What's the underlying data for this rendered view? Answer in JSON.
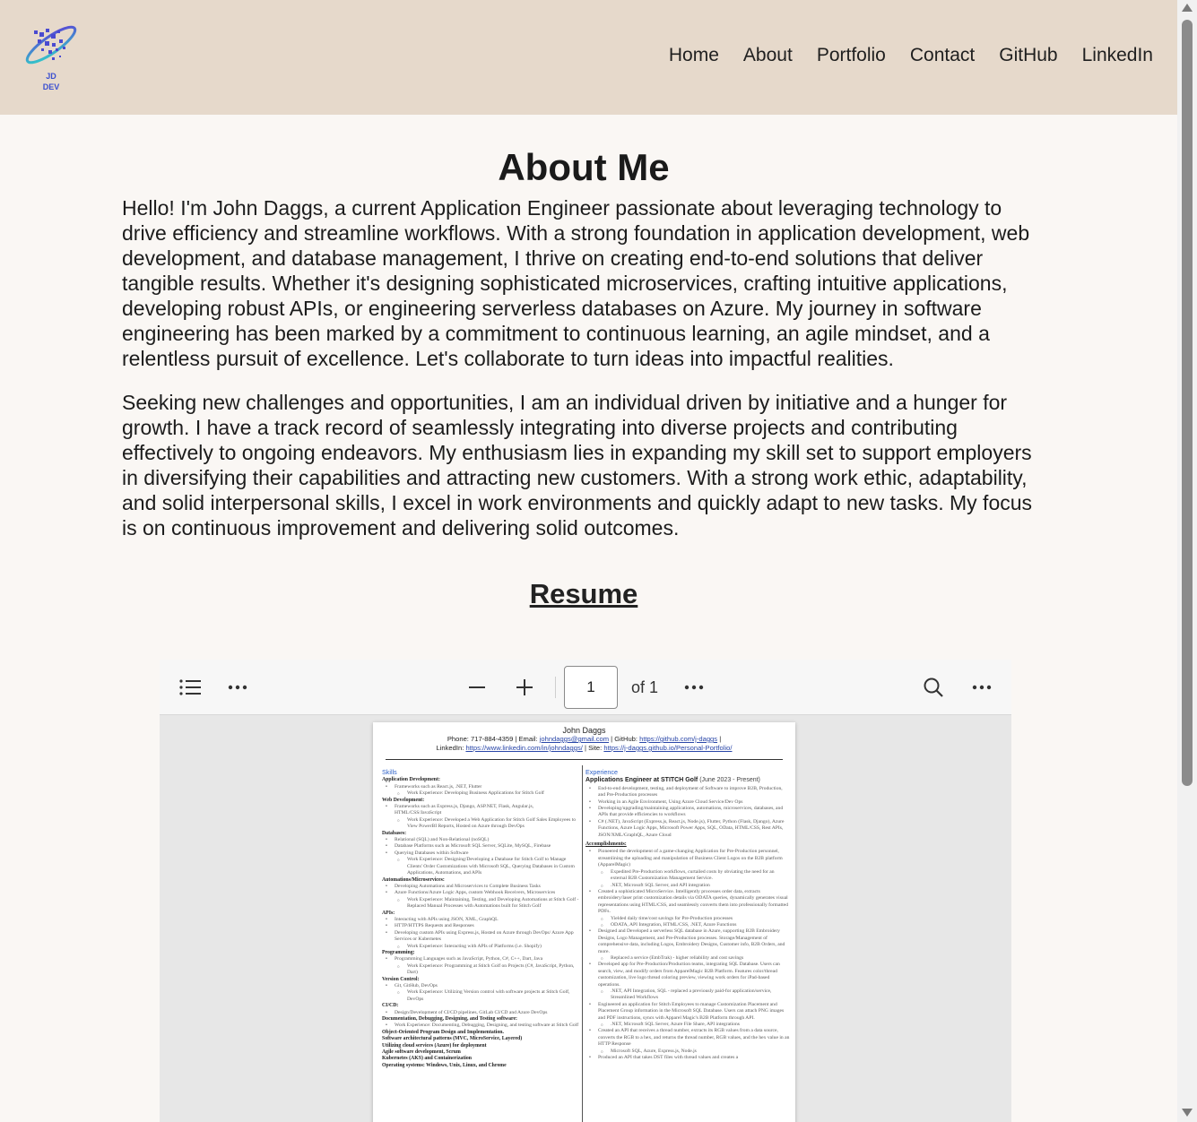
{
  "header": {
    "logo_text": "JD DEV",
    "nav": [
      "Home",
      "About",
      "Portfolio",
      "Contact",
      "GitHub",
      "LinkedIn"
    ]
  },
  "about": {
    "title": "About Me",
    "paragraphs": [
      "Hello! I'm John Daggs, a current Application Engineer passionate about leveraging technology to drive efficiency and streamline workflows. With a strong foundation in application development, web development, and database management, I thrive on creating end-to-end solutions that deliver tangible results. Whether it's designing sophisticated microservices, crafting intuitive applications, developing robust APIs, or engineering serverless databases on Azure. My journey in software engineering has been marked by a commitment to continuous learning, an agile mindset, and a relentless pursuit of excellence. Let's collaborate to turn ideas into impactful realities.",
      "Seeking new challenges and opportunities, I am an individual driven by initiative and a hunger for growth. I have a track record of seamlessly integrating into diverse projects and contributing effectively to ongoing endeavors. My enthusiasm lies in expanding my skill set to support employers in diversifying their capabilities and attracting new customers. With a strong work ethic, adaptability, and solid interpersonal skills, I excel in work environments and quickly adapt to new tasks. My focus is on continuous improvement and delivering solid outcomes."
    ]
  },
  "resume": {
    "title": "Resume",
    "viewer": {
      "page_value": "1",
      "page_total_label": "of 1"
    },
    "pdf": {
      "name": "John Daggs",
      "contact_line1_prefix": "Phone: 717-884-4359 | Email: ",
      "email": "johndaggs@gmail.com",
      "github_prefix": " | GitHub: ",
      "github": "https://github.com/j-daggs",
      "line1_suffix": " |",
      "linkedin_prefix": "LinkedIn: ",
      "linkedin": "https://www.linkedin.com/in/johndaggs/",
      "site_prefix": " | Site: ",
      "site": "https://j-daggs.github.io/Personal-Portfolio/",
      "skills_heading": "Skills",
      "experience_heading": "Experience",
      "job_title": "Applications Engineer at STITCH Golf",
      "job_dates": "(June 2023 - Present)",
      "accomplishments_heading": "Accomplishments:",
      "left_lines": [
        {
          "k": "sub",
          "t": "Application Development:"
        },
        {
          "k": "b",
          "t": "Frameworks such as React.js, .NET, Flutter"
        },
        {
          "k": "b2",
          "t": "Work Experience: Developing Business Applications for Stitch Golf"
        },
        {
          "k": "sub",
          "t": "Web Development:"
        },
        {
          "k": "b",
          "t": "Frameworks such as Express.js, Django, ASP.NET, Flask, Angular.js, HTML/CSS/JavaScript"
        },
        {
          "k": "b2",
          "t": "Work Experience: Developed a Web Application for Stitch Golf Sales Employees to View PowerBI Reports, Hosted on Azure through DevOps"
        },
        {
          "k": "sub",
          "t": "Databases:"
        },
        {
          "k": "b",
          "t": "Relational (SQL) and Non-Relational (noSQL)"
        },
        {
          "k": "b",
          "t": "Database Platforms such as Microsoft SQL Server, SQLite, MySQL, Firebase"
        },
        {
          "k": "b",
          "t": "Querying Databases within Software"
        },
        {
          "k": "b2",
          "t": "Work Experience: Designing/Developing a Database for Stitch Golf to Manage Clients' Order Customizations with Microsoft SQL, Querying Databases in Custom Applications, Automations, and APIs"
        },
        {
          "k": "sub",
          "t": "Automations/Microservices:"
        },
        {
          "k": "b",
          "t": "Developing Automations and Microservices to Complete Business Tasks"
        },
        {
          "k": "b",
          "t": "Azure Functions/Azure Logic Apps, custom Webhook Receivers, Microservices"
        },
        {
          "k": "b2",
          "t": "Work Experience: Maintaining, Testing, and Developing Automations at Stitch Golf - Replaced Manual Processes with Automations built for Stitch Golf"
        },
        {
          "k": "sub",
          "t": "APIs:"
        },
        {
          "k": "b",
          "t": "Interacting with APIs using JSON, XML, GraphQL"
        },
        {
          "k": "b",
          "t": "HTTP/HTTPS Requests and Responses"
        },
        {
          "k": "b",
          "t": "Developing custom APIs using Express.js, Hosted on Azure through DevOps/ Azure App Services or Kubernetes"
        },
        {
          "k": "b2",
          "t": "Work Experience: Interacting with APIs of Platforms (i.e. Shopify)"
        },
        {
          "k": "sub",
          "t": "Programming:"
        },
        {
          "k": "b",
          "t": "Programming Languages such as JavaScript, Python, C#, C++, Dart, Java"
        },
        {
          "k": "b2",
          "t": "Work Experience: Programming at Stitch Golf on Projects (C#, JavaScript, Python, Dart)"
        },
        {
          "k": "sub",
          "t": "Version Control:"
        },
        {
          "k": "b",
          "t": "Git, GitHub, DevOps"
        },
        {
          "k": "b2",
          "t": "Work Experience: Utilizing Version control with software projects at Stitch Golf, DevOps"
        },
        {
          "k": "sub",
          "t": "CI/CD:"
        },
        {
          "k": "b",
          "t": "Design/Development of CI/CD pipelines, GitLab CI/CD and Azure DevOps"
        },
        {
          "k": "sub",
          "t": "Documentation, Debugging, Designing, and Testing software:"
        },
        {
          "k": "b",
          "t": "Work Experience: Documenting, Debugging, Designing, and testing software at Stitch Golf"
        },
        {
          "k": "sub",
          "t": "Object-Oriented Program Design and Implementation."
        },
        {
          "k": "sub",
          "t": "Software architectural patterns (MVC, MicroService, Layered)"
        },
        {
          "k": "sub",
          "t": "Utilizing cloud services (Azure) for deployment"
        },
        {
          "k": "sub",
          "t": "Agile software development, Scrum"
        },
        {
          "k": "sub",
          "t": "Kubernetes (AKS) and Containerization"
        },
        {
          "k": "sub",
          "t": "Operating systems: Windows, Unix, Linux, and Chrome"
        }
      ],
      "right_lines_top": [
        {
          "k": "b",
          "t": "End-to-end development, testing, and deployment of Software to improve B2B, Production, and Pre-Production processes"
        },
        {
          "k": "b",
          "t": "Working in an Agile Environment, Using Azure Cloud Service/Dev Ops"
        },
        {
          "k": "b",
          "t": "Developing/upgrading/maintaining applications, automations, microservices, databases, and APIs that provide efficiencies to workflows"
        },
        {
          "k": "b",
          "t": "C# (.NET), JavaScript (Express.js, React.js, Node.js), Flutter, Python (Flask, Django), Azure Functions, Azure Logic Apps, Microsoft Power Apps, SQL, OData, HTML/CSS, Rest APIs, JSON/XML/GraphQL, Azure Cloud"
        }
      ],
      "right_lines_acc": [
        {
          "k": "b",
          "t": "Pioneered the development of a game-changing Application for Pre-Production personnel, streamlining the uploading and manipulation of Business Client Logos on the B2B platform (ApparelMagic)"
        },
        {
          "k": "b2",
          "t": "Expedited Pre-Production workflows, curtailed costs by obviating the need for an external B2B Customization Management Service."
        },
        {
          "k": "b2",
          "t": ".NET, Microsoft SQL Server, and API integration"
        },
        {
          "k": "b",
          "t": "Created a sophisticated MicroService. Intelligently processes order data, extracts embroidery/laser print customization details via ODATA queries, dynamically generates visual representations using HTML/CSS, and seamlessly converts them into professionally formatted PDFs."
        },
        {
          "k": "b2",
          "t": "Yielded daily time/cost savings for Pre-Production processes"
        },
        {
          "k": "b2",
          "t": "ODATA, API Integration, HTML/CSS, .NET, Azure Functions"
        },
        {
          "k": "b",
          "t": "Designed and Developed a serverless SQL database in Azure, supporting B2B Embroidery Designs, Logo Management, and Pre-Production processes. Storage/Management of comprehensive data, including Logos, Embroidery Designs, Customer info, B2B Orders, and more."
        },
        {
          "k": "b2",
          "t": "Replaced a service (EmbTrak) - higher reliability and cost savings"
        },
        {
          "k": "b",
          "t": "Developed app for Pre-Production/Production teams, integrating SQL Database. Users can search, view, and modify orders from ApparelMagic B2B Platform. Features color/thread customization, live logo thread coloring preview, viewing work orders for iPad-based operations."
        },
        {
          "k": "b2",
          "t": ".NET, API Integration, SQL - replaced a previously paid-for application/service, Streamlined Workflows"
        },
        {
          "k": "b",
          "t": "Engineered an application for Stitch Employees to manage Customization Placement and Placement Group information in the Microsoft SQL Database. Users can attach PNG images and PDF instructions, syncs with Apparel Magic's B2B Platform through API."
        },
        {
          "k": "b2",
          "t": ".NET, Microsoft SQL Server, Azure File Share, API integrations"
        },
        {
          "k": "b",
          "t": "Created an API that receives a thread number, extracts its RGB values from a data source, converts the RGB to a hex, and returns the thread number, RGB values, and the hex value in an HTTP Response"
        },
        {
          "k": "b2",
          "t": "Microsoft SQL, Azure, Express.js, Node.js"
        },
        {
          "k": "b",
          "t": "Produced an API that takes DST files with thread values and creates a"
        }
      ]
    }
  },
  "colors": {
    "header_bg": "#e6d9cb",
    "page_bg": "#faf7f4",
    "link_blue": "#2946a8",
    "section_blue": "#2b5fc7"
  },
  "icons": {
    "toolbar_left": [
      "list-icon",
      "more-horizontal-icon"
    ],
    "toolbar_zoom": [
      "minus-icon",
      "plus-icon"
    ],
    "toolbar_right": [
      "search-icon",
      "more-horizontal-icon"
    ]
  }
}
